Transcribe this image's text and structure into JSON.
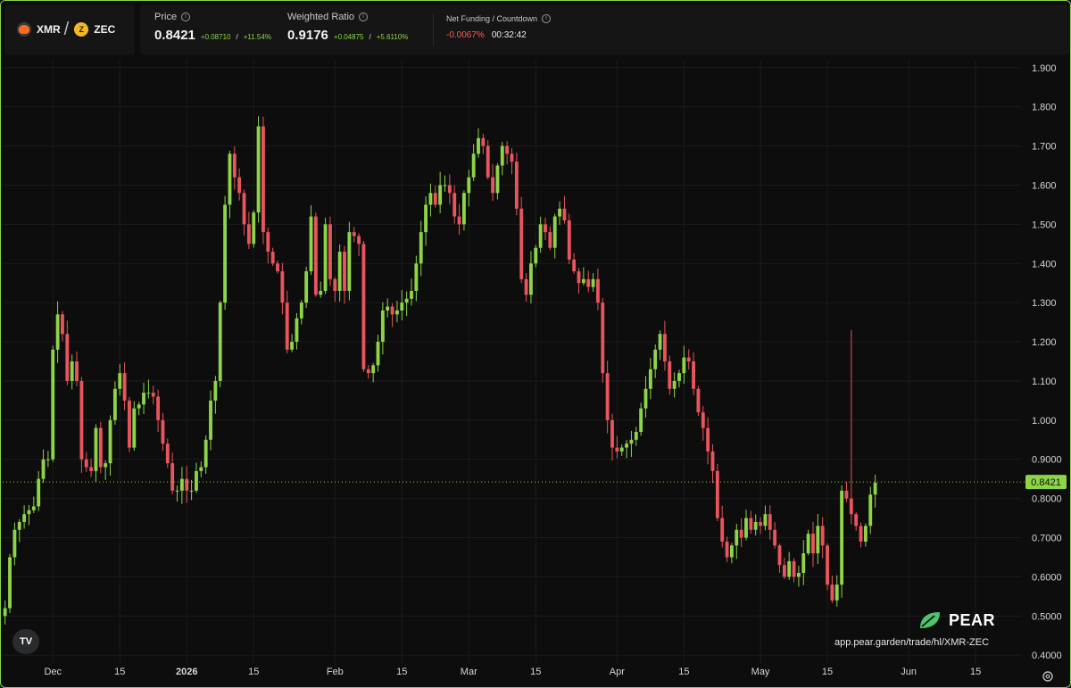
{
  "header": {
    "base_symbol": "XMR",
    "quote_symbol": "ZEC",
    "separator": "/",
    "zec_glyph": "Z",
    "price": {
      "label": "Price",
      "value": "0.8421",
      "change_abs": "+0.08710",
      "sep": "/",
      "change_pct": "+11.54%"
    },
    "ratio": {
      "label": "Weighted Ratio",
      "value": "0.9176",
      "change_abs": "+0.04875",
      "sep": "/",
      "change_pct": "+5.6110%"
    },
    "funding": {
      "label": "Net Funding / Countdown",
      "rate": "-0.0067%",
      "countdown": "00:32:42"
    },
    "info_glyph": "i"
  },
  "brand": {
    "name": "PEAR",
    "url": "app.pear.garden/trade/hl/XMR-ZEC",
    "tv_logo_text": "TV"
  },
  "colors": {
    "up": "#8ed44a",
    "down": "#e8555d",
    "grid": "#1b1d1b",
    "axis_text": "#d6d6d6",
    "price_line": "#8ed44a",
    "frame": "#8ed44a"
  },
  "icons": {
    "info": "info-icon",
    "settings": "gear-icon",
    "tradingview": "tradingview-logo-icon",
    "pear": "leaf-icon",
    "xmr": "monero-coin-icon",
    "zec": "zcash-coin-icon"
  },
  "chart_data": {
    "type": "candlestick",
    "title": "",
    "ylim": [
      0.38,
      1.92
    ],
    "y_ticks": [
      "0.4000",
      "0.5000",
      "0.6000",
      "0.7000",
      "0.8000",
      "0.9000",
      "1.000",
      "1.100",
      "1.200",
      "1.300",
      "1.400",
      "1.500",
      "1.600",
      "1.700",
      "1.800",
      "1.900"
    ],
    "y_tick_values": [
      0.4,
      0.5,
      0.6,
      0.7,
      0.8,
      0.9,
      1.0,
      1.1,
      1.2,
      1.3,
      1.4,
      1.5,
      1.6,
      1.7,
      1.8,
      1.9
    ],
    "x_ticks": [
      {
        "label": "Dec",
        "index": 10,
        "bold": false
      },
      {
        "label": "15",
        "index": 24,
        "bold": false
      },
      {
        "label": "2026",
        "index": 38,
        "bold": true
      },
      {
        "label": "15",
        "index": 52,
        "bold": false
      },
      {
        "label": "Feb",
        "index": 69,
        "bold": false
      },
      {
        "label": "15",
        "index": 83,
        "bold": false
      },
      {
        "label": "Mar",
        "index": 97,
        "bold": false
      },
      {
        "label": "15",
        "index": 111,
        "bold": false
      },
      {
        "label": "Apr",
        "index": 128,
        "bold": false
      },
      {
        "label": "15",
        "index": 142,
        "bold": false
      },
      {
        "label": "May",
        "index": 158,
        "bold": false
      },
      {
        "label": "15",
        "index": 172,
        "bold": false
      },
      {
        "label": "Jun",
        "index": 189,
        "bold": false
      },
      {
        "label": "15",
        "index": 203,
        "bold": false
      }
    ],
    "last_price": 0.8421,
    "last_price_label": "0.8421",
    "x_slots": 213,
    "closes": [
      0.52,
      0.65,
      0.72,
      0.74,
      0.76,
      0.77,
      0.78,
      0.85,
      0.9,
      0.9,
      1.18,
      1.27,
      1.22,
      1.1,
      1.15,
      1.1,
      0.9,
      0.88,
      0.87,
      0.98,
      0.88,
      0.89,
      1.0,
      1.08,
      1.12,
      1.05,
      0.93,
      1.03,
      1.04,
      1.07,
      1.07,
      1.06,
      1.0,
      0.94,
      0.89,
      0.82,
      0.82,
      0.85,
      0.82,
      0.82,
      0.87,
      0.88,
      0.95,
      1.05,
      1.1,
      1.3,
      1.55,
      1.68,
      1.62,
      1.58,
      1.5,
      1.45,
      1.53,
      1.75,
      1.48,
      1.43,
      1.4,
      1.38,
      1.3,
      1.18,
      1.2,
      1.26,
      1.3,
      1.38,
      1.52,
      1.32,
      1.33,
      1.5,
      1.36,
      1.33,
      1.43,
      1.33,
      1.48,
      1.47,
      1.45,
      1.13,
      1.12,
      1.14,
      1.2,
      1.28,
      1.29,
      1.27,
      1.28,
      1.3,
      1.31,
      1.33,
      1.4,
      1.48,
      1.55,
      1.58,
      1.55,
      1.6,
      1.6,
      1.58,
      1.52,
      1.5,
      1.58,
      1.62,
      1.68,
      1.72,
      1.7,
      1.62,
      1.58,
      1.65,
      1.7,
      1.68,
      1.66,
      1.54,
      1.36,
      1.32,
      1.4,
      1.44,
      1.5,
      1.48,
      1.44,
      1.52,
      1.54,
      1.51,
      1.41,
      1.38,
      1.35,
      1.36,
      1.34,
      1.36,
      1.3,
      1.12,
      1.0,
      0.93,
      0.92,
      0.93,
      0.94,
      0.95,
      0.97,
      1.03,
      1.08,
      1.13,
      1.18,
      1.22,
      1.15,
      1.08,
      1.1,
      1.12,
      1.16,
      1.15,
      1.08,
      1.02,
      0.98,
      0.92,
      0.87,
      0.75,
      0.69,
      0.65,
      0.68,
      0.72,
      0.7,
      0.75,
      0.72,
      0.74,
      0.73,
      0.76,
      0.72,
      0.68,
      0.63,
      0.6,
      0.64,
      0.6,
      0.61,
      0.66,
      0.71,
      0.66,
      0.73,
      0.68,
      0.58,
      0.54,
      0.58,
      0.82,
      0.8,
      0.76,
      0.73,
      0.69,
      0.73,
      0.81,
      0.84
    ]
  }
}
